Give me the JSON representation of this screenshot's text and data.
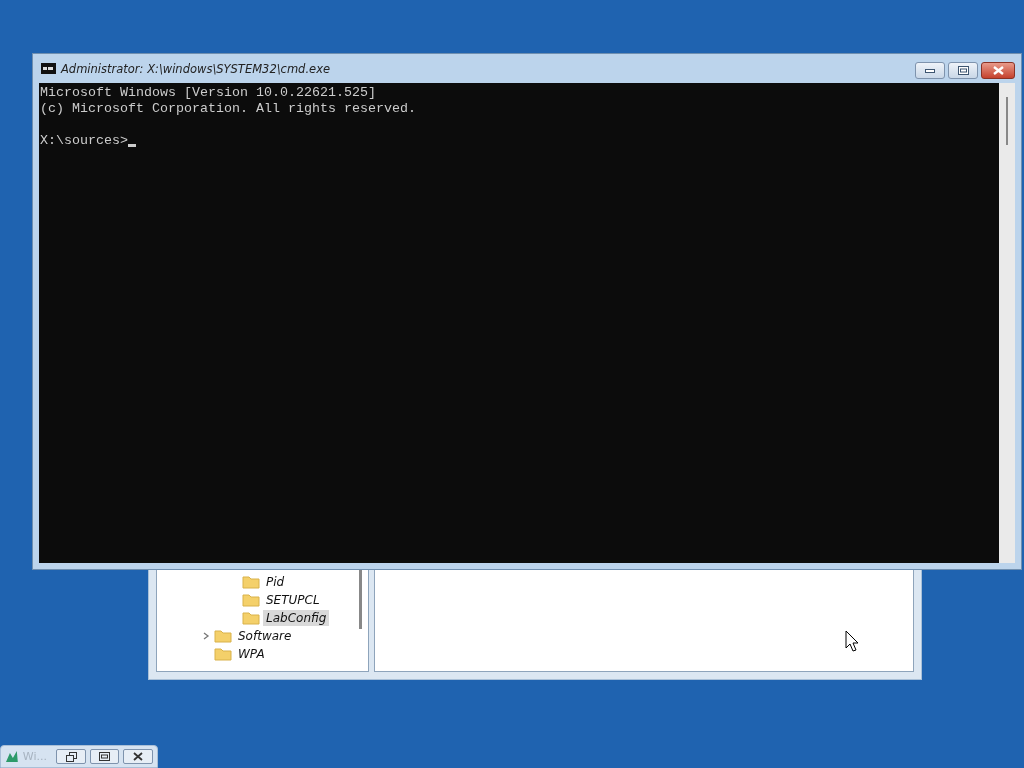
{
  "console_window": {
    "title": "Administrator: X:\\windows\\SYSTEM32\\cmd.exe",
    "lines": [
      "Microsoft Windows [Version 10.0.22621.525]",
      "(c) Microsoft Corporation. All rights reserved."
    ],
    "prompt": "X:\\sources>"
  },
  "registry_window": {
    "tree": [
      {
        "children": [
          {
            "label": "Pid",
            "selected": false
          },
          {
            "label": "SETUPCL",
            "selected": false
          },
          {
            "label": "LabConfig",
            "selected": true
          }
        ]
      },
      {
        "label": "Software",
        "selected": false,
        "expanded": false
      },
      {
        "label": "WPA",
        "selected": false
      }
    ]
  },
  "minimized_window": {
    "title": "Wi..."
  }
}
